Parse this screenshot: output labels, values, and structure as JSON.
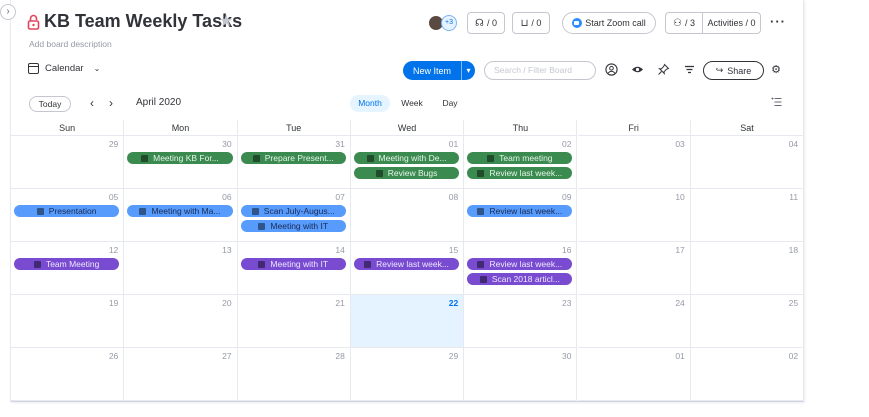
{
  "header": {
    "title": "KB Team Weekly Tasks",
    "description": "Add board description",
    "avatar_secondary": "+3",
    "updates_count": "/ 0",
    "inbox_count": "/ 0",
    "zoom_label": "Start Zoom call",
    "members_count": "/ 3",
    "activities_label": "Activities / 0",
    "more_icon": "···"
  },
  "toolbar": {
    "view_label": "Calendar",
    "new_item_label": "New Item",
    "search_placeholder": "Search / Filter Board",
    "share_label": "Share"
  },
  "calendar_nav": {
    "today_label": "Today",
    "month_label": "April 2020",
    "modes": [
      "Month",
      "Week",
      "Day"
    ],
    "active_mode": "Month"
  },
  "weekdays": [
    "Sun",
    "Mon",
    "Tue",
    "Wed",
    "Thu",
    "Fri",
    "Sat"
  ],
  "weeks": [
    {
      "days": [
        "29",
        "30",
        "31",
        "01",
        "02",
        "03",
        "04"
      ]
    },
    {
      "days": [
        "05",
        "06",
        "07",
        "08",
        "09",
        "10",
        "11"
      ]
    },
    {
      "days": [
        "12",
        "13",
        "14",
        "15",
        "16",
        "17",
        "18"
      ]
    },
    {
      "days": [
        "19",
        "20",
        "21",
        "22",
        "23",
        "24",
        "25"
      ]
    },
    {
      "days": [
        "26",
        "27",
        "28",
        "29",
        "30",
        "01",
        "02"
      ]
    }
  ],
  "current_day": {
    "week": 3,
    "day": 3
  },
  "events": [
    {
      "week": 0,
      "day": 1,
      "slot": 0,
      "label": "Meeting KB For...",
      "color": "green"
    },
    {
      "week": 0,
      "day": 2,
      "slot": 0,
      "label": "Prepare Present...",
      "color": "green"
    },
    {
      "week": 0,
      "day": 3,
      "slot": 0,
      "label": "Meeting with De...",
      "color": "green"
    },
    {
      "week": 0,
      "day": 3,
      "slot": 1,
      "label": "Review Bugs",
      "color": "green"
    },
    {
      "week": 0,
      "day": 4,
      "slot": 0,
      "label": "Team meeting",
      "color": "green"
    },
    {
      "week": 0,
      "day": 4,
      "slot": 1,
      "label": "Review last week...",
      "color": "green"
    },
    {
      "week": 1,
      "day": 0,
      "slot": 0,
      "label": "Presentation",
      "color": "blue"
    },
    {
      "week": 1,
      "day": 1,
      "slot": 0,
      "label": "Meeting with Ma...",
      "color": "blue"
    },
    {
      "week": 1,
      "day": 2,
      "slot": 0,
      "label": "Scan July-Augus...",
      "color": "blue"
    },
    {
      "week": 1,
      "day": 2,
      "slot": 1,
      "label": "Meeting with IT",
      "color": "blue"
    },
    {
      "week": 1,
      "day": 4,
      "slot": 0,
      "label": "Review last week...",
      "color": "blue"
    },
    {
      "week": 2,
      "day": 0,
      "slot": 0,
      "label": "Team Meeting",
      "color": "purple"
    },
    {
      "week": 2,
      "day": 2,
      "slot": 0,
      "label": "Meeting with IT",
      "color": "purple"
    },
    {
      "week": 2,
      "day": 3,
      "slot": 0,
      "label": "Review last week...",
      "color": "purple"
    },
    {
      "week": 2,
      "day": 4,
      "slot": 0,
      "label": "Review last week...",
      "color": "purple"
    },
    {
      "week": 2,
      "day": 4,
      "slot": 1,
      "label": "Scan 2018 articl...",
      "color": "purple"
    }
  ],
  "colors": {
    "green": "#3b8a50",
    "blue": "#579bfc",
    "purple": "#784bd1",
    "primary": "#0073ea",
    "today_bg": "#e5f2ff"
  },
  "icons": {
    "lock": "lock-icon",
    "star": "star-icon",
    "updates": "speech-bubble-icon",
    "inbox": "inbox-icon",
    "zoom": "zoom-camera-icon",
    "members": "people-icon",
    "calendar": "calendar-icon",
    "person_filter": "person-icon",
    "eye": "eye-icon",
    "pin": "pin-icon",
    "filter": "filter-icon",
    "share": "share-arrow-icon",
    "settings": "gear-icon",
    "list_toggle": "list-icon"
  }
}
